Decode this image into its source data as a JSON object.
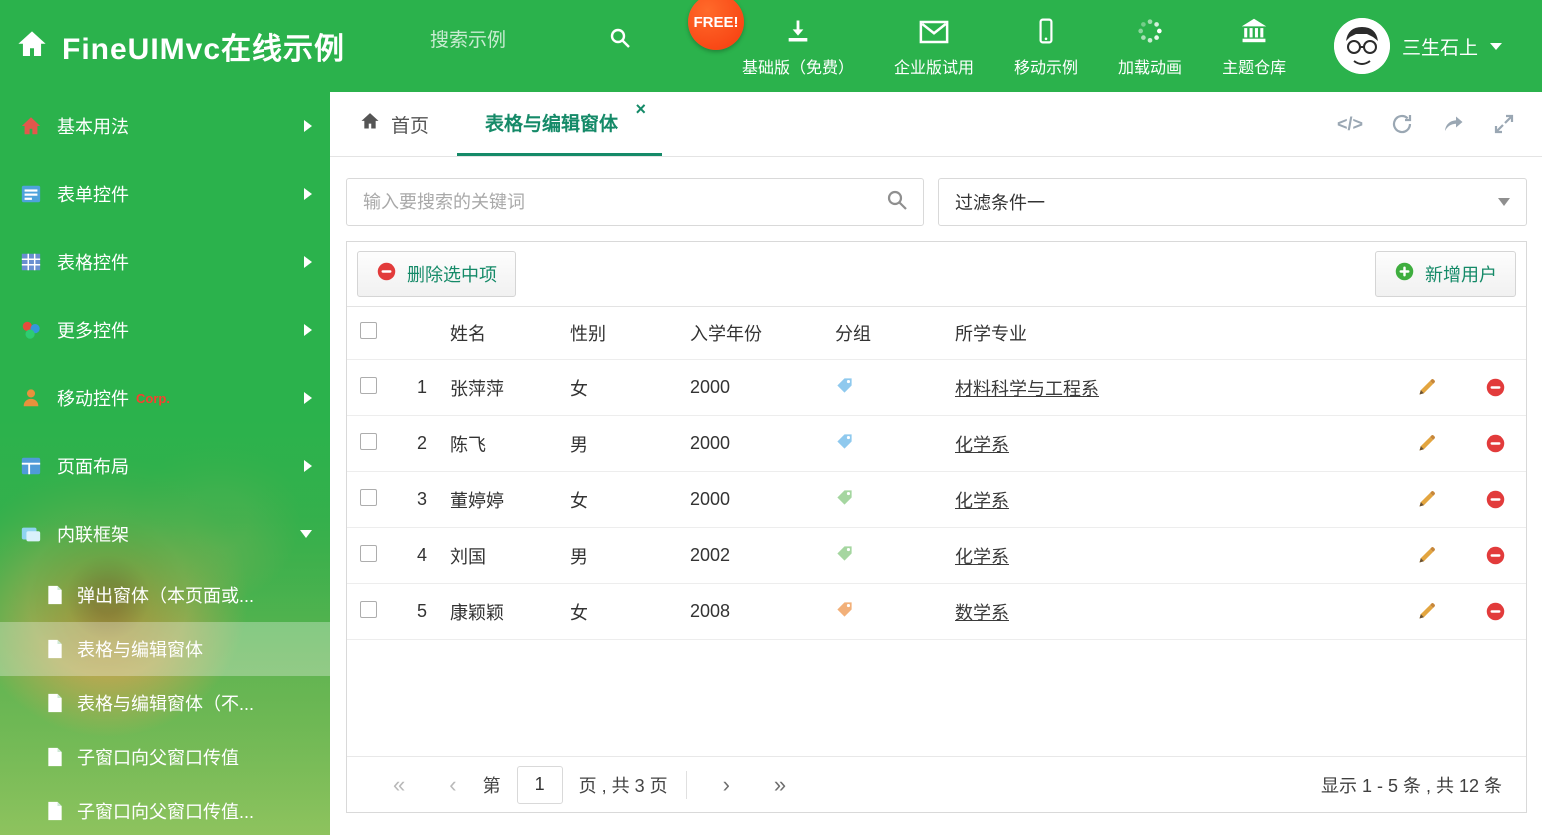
{
  "header": {
    "title": "FineUIMvc在线示例",
    "search_placeholder": "搜索示例",
    "free_badge": "FREE!",
    "nav": [
      {
        "label": "基础版（免费）"
      },
      {
        "label": "企业版试用"
      },
      {
        "label": "移动示例"
      },
      {
        "label": "加载动画"
      },
      {
        "label": "主题仓库"
      }
    ],
    "user_name": "三生石上"
  },
  "sidebar": {
    "items": [
      {
        "label": "基本用法"
      },
      {
        "label": "表单控件"
      },
      {
        "label": "表格控件"
      },
      {
        "label": "更多控件"
      },
      {
        "label": "移动控件",
        "badge": "Corp."
      },
      {
        "label": "页面布局"
      },
      {
        "label": "内联框架"
      }
    ],
    "subitems": [
      {
        "label": "弹出窗体（本页面或..."
      },
      {
        "label": "表格与编辑窗体"
      },
      {
        "label": "表格与编辑窗体（不..."
      },
      {
        "label": "子窗口向父窗口传值"
      },
      {
        "label": "子窗口向父窗口传值..."
      }
    ]
  },
  "tabs": {
    "home": "首页",
    "active": "表格与编辑窗体",
    "close_glyph": "×"
  },
  "tools": {
    "code_label": "</>"
  },
  "filter": {
    "search_placeholder": "输入要搜索的关键词",
    "dropdown_value": "过滤条件一"
  },
  "grid": {
    "delete_button": "删除选中项",
    "add_button": "新增用户",
    "columns": {
      "name": "姓名",
      "gender": "性别",
      "year": "入学年份",
      "group": "分组",
      "major": "所学专业"
    },
    "rows": [
      {
        "num": "1",
        "name": "张萍萍",
        "gender": "女",
        "year": "2000",
        "tag_color": "#8fc9ee",
        "major": "材料科学与工程系"
      },
      {
        "num": "2",
        "name": "陈飞",
        "gender": "男",
        "year": "2000",
        "tag_color": "#8fc9ee",
        "major": "化学系"
      },
      {
        "num": "3",
        "name": "董婷婷",
        "gender": "女",
        "year": "2000",
        "tag_color": "#a5d6a0",
        "major": "化学系"
      },
      {
        "num": "4",
        "name": "刘国",
        "gender": "男",
        "year": "2002",
        "tag_color": "#a5d6a0",
        "major": "化学系"
      },
      {
        "num": "5",
        "name": "康颖颖",
        "gender": "女",
        "year": "2008",
        "tag_color": "#f2b079",
        "major": "数学系"
      }
    ]
  },
  "pagination": {
    "first_glyph": "«",
    "prev_glyph": "‹",
    "next_glyph": "›",
    "last_glyph": "»",
    "page_prefix": "第",
    "page_value": "1",
    "page_suffix": "页 , 共 3 页",
    "summary": "显示 1 - 5 条 , 共 12 条"
  },
  "colors": {
    "header_green": "#2bb24c",
    "accent": "#158a68",
    "delete_red": "#e23b3b",
    "add_green": "#3fae3f"
  }
}
